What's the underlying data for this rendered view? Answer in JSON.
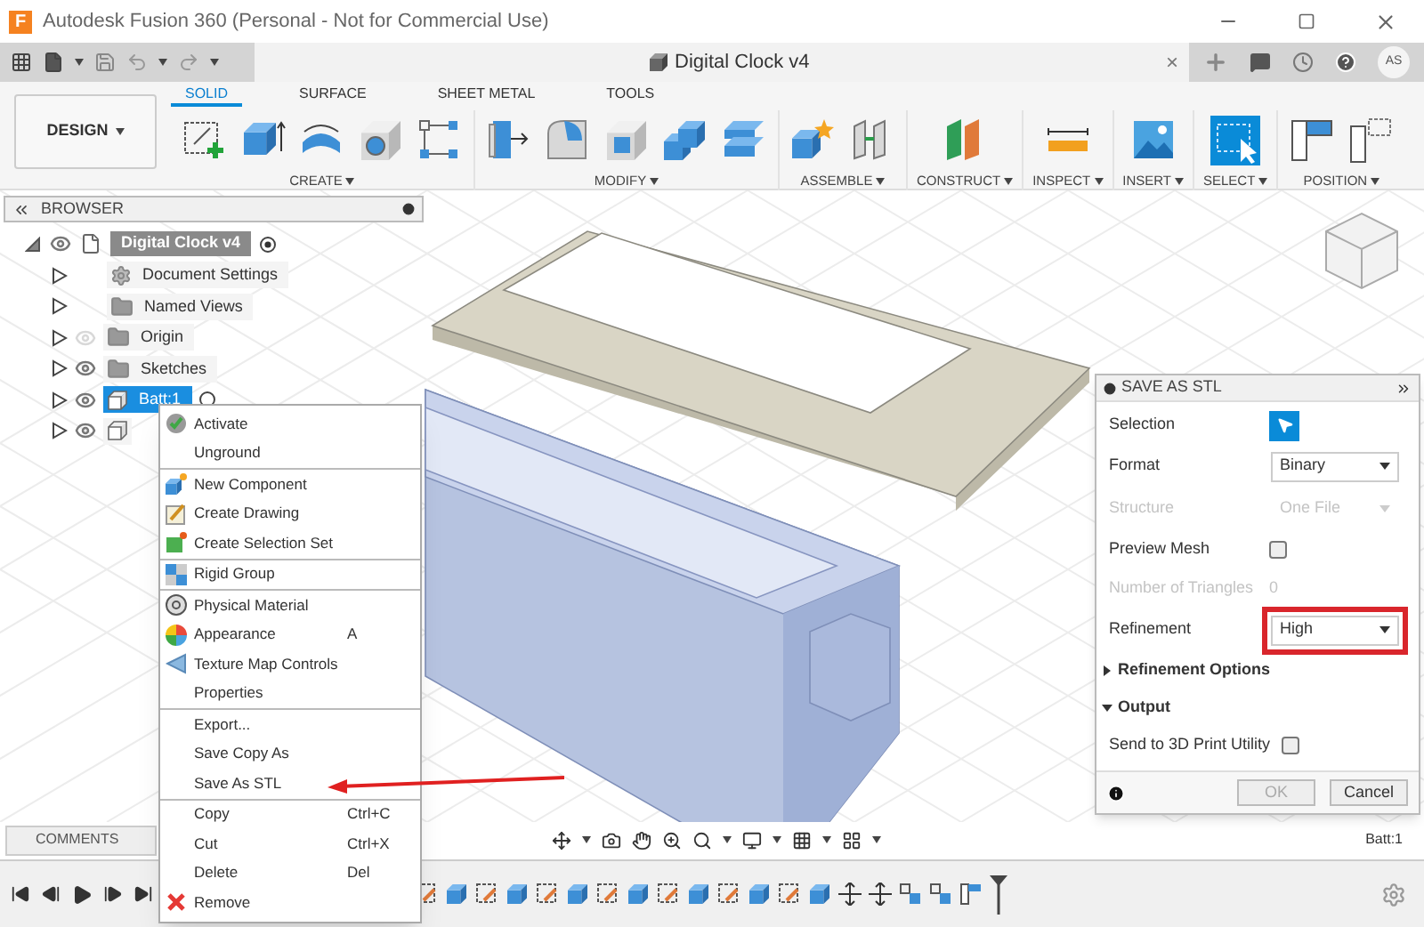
{
  "window": {
    "title": "Autodesk Fusion 360 (Personal - Not for Commercial Use)",
    "logo_letter": "F"
  },
  "document_tab": {
    "title": "Digital Clock v4",
    "close_glyph": "×"
  },
  "user_badge": {
    "initials": "AS"
  },
  "workspace_button": {
    "label": "DESIGN"
  },
  "ribbon_tabs": [
    {
      "label": "SOLID",
      "selected": true
    },
    {
      "label": "SURFACE",
      "selected": false
    },
    {
      "label": "SHEET METAL",
      "selected": false
    },
    {
      "label": "TOOLS",
      "selected": false
    }
  ],
  "ribbon_groups": [
    {
      "label": "CREATE"
    },
    {
      "label": "MODIFY"
    },
    {
      "label": "ASSEMBLE"
    },
    {
      "label": "CONSTRUCT"
    },
    {
      "label": "INSPECT"
    },
    {
      "label": "INSERT"
    },
    {
      "label": "SELECT"
    },
    {
      "label": "POSITION"
    }
  ],
  "browser": {
    "title": "BROWSER",
    "root": {
      "label": "Digital Clock v4",
      "expanded": true,
      "visible": true,
      "children": [
        {
          "kind": "settings",
          "label": "Document Settings",
          "expanded": false,
          "selected": false
        },
        {
          "kind": "folder",
          "label": "Named Views",
          "expanded": false,
          "selected": false
        },
        {
          "kind": "folder",
          "label": "Origin",
          "expanded": false,
          "visible": false,
          "selected": false
        },
        {
          "kind": "folder",
          "label": "Sketches",
          "expanded": false,
          "visible": true,
          "selected": false
        },
        {
          "kind": "component",
          "label": "Batt:1",
          "expanded": false,
          "visible": true,
          "selected": true
        },
        {
          "kind": "component",
          "expanded": false,
          "visible": true,
          "selected": false
        }
      ]
    }
  },
  "context_menu": {
    "sections": [
      [
        {
          "label": "Activate"
        },
        {
          "label": "Unground"
        }
      ],
      [
        {
          "label": "New Component"
        },
        {
          "label": "Create Drawing"
        },
        {
          "label": "Create Selection Set"
        }
      ],
      [
        {
          "label": "Rigid Group"
        }
      ],
      [
        {
          "label": "Physical Material"
        },
        {
          "label": "Appearance",
          "shortcut": "A"
        },
        {
          "label": "Texture Map Controls"
        },
        {
          "label": "Properties"
        }
      ],
      [
        {
          "label": "Export..."
        },
        {
          "label": "Save Copy As"
        },
        {
          "label": "Save As STL"
        }
      ],
      [
        {
          "label": "Copy",
          "shortcut": "Ctrl+C"
        },
        {
          "label": "Cut",
          "shortcut": "Ctrl+X"
        },
        {
          "label": "Delete",
          "shortcut": "Del"
        },
        {
          "label": "Remove"
        }
      ]
    ]
  },
  "save_stl_panel": {
    "title": "SAVE AS STL",
    "rows": [
      {
        "kind": "selection",
        "label": "Selection",
        "active": true
      },
      {
        "kind": "dropdown",
        "label": "Format",
        "value": "Binary",
        "disabled": false,
        "highlighted": false
      },
      {
        "kind": "dropdown",
        "label": "Structure",
        "value": "One File",
        "disabled": true,
        "highlighted": false
      },
      {
        "kind": "checkbox",
        "label": "Preview Mesh",
        "checked": false
      },
      {
        "kind": "number",
        "label": "Number of Triangles",
        "value": "0",
        "disabled": true
      },
      {
        "kind": "dropdown",
        "label": "Refinement",
        "value": "High",
        "disabled": false,
        "highlighted": true
      }
    ],
    "sections": [
      {
        "label": "Refinement Options",
        "expanded": false
      },
      {
        "label": "Output",
        "expanded": true,
        "rows": [
          {
            "kind": "checkbox",
            "label": "Send to 3D Print Utility",
            "checked": false
          }
        ]
      }
    ],
    "buttons": [
      {
        "label": "OK",
        "disabled": true
      },
      {
        "label": "Cancel",
        "disabled": false
      }
    ]
  },
  "comments": {
    "label": "COMMENTS"
  },
  "viewport": {
    "status_label": "Batt:1"
  }
}
